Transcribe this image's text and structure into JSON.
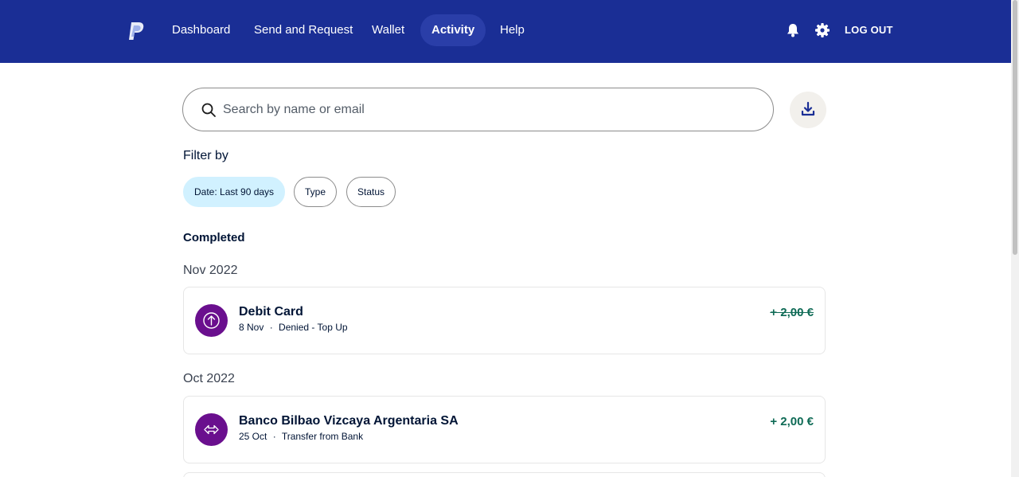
{
  "header": {
    "nav": [
      "Dashboard",
      "Send and Request",
      "Wallet",
      "Activity",
      "Help"
    ],
    "active_nav": "Activity",
    "logout_label": "LOG OUT",
    "icons": [
      "paypal-logo",
      "bell-icon",
      "gear-icon"
    ]
  },
  "search": {
    "placeholder": "Search by name or email",
    "value": ""
  },
  "filter": {
    "label": "Filter by",
    "chips": [
      "Date: Last 90 days",
      "Type",
      "Status"
    ],
    "selected": "Date: Last 90 days"
  },
  "activity": {
    "section_title": "Completed",
    "groups": [
      {
        "month": "Nov 2022",
        "transactions": [
          {
            "name": "Debit Card",
            "date": "8 Nov",
            "separator": "·",
            "detail": "Denied - Top Up",
            "amount": "+ 2,00 €",
            "struck": true,
            "icon": "upload-icon"
          }
        ]
      },
      {
        "month": "Oct 2022",
        "transactions": [
          {
            "name": "Banco Bilbao Vizcaya Argentaria SA",
            "date": "25 Oct",
            "separator": "·",
            "detail": "Transfer from Bank",
            "amount": "+ 2,00 €",
            "struck": false,
            "icon": "transfer-icon"
          }
        ]
      }
    ]
  },
  "colors": {
    "header_bg": "#1a2e95",
    "active_nav_bg": "#2a3ea8",
    "chip_selected_bg": "#d1f1ff",
    "icon_bg": "#6a0f8e",
    "amount": "#0e6a55"
  }
}
